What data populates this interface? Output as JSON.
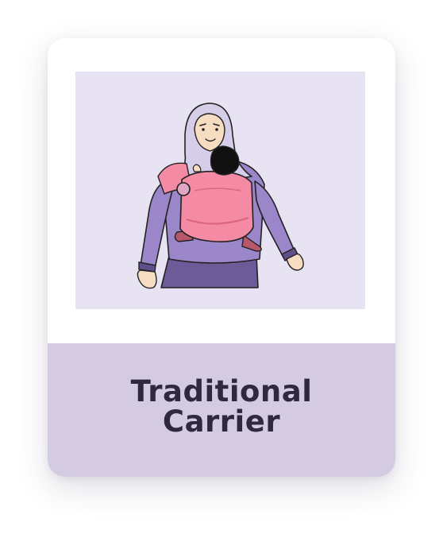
{
  "card": {
    "title": "Traditional\nCarrier",
    "illustration_icon": "mother-with-baby-carrier-illustration"
  },
  "colors": {
    "image_background": "#e7e3f2",
    "label_background": "#d4cbe2",
    "title_text": "#2e2840",
    "carrier_pink": "#f48aa3",
    "garment_purple": "#9a86c8",
    "hijab_lavender": "#d6cde8"
  }
}
